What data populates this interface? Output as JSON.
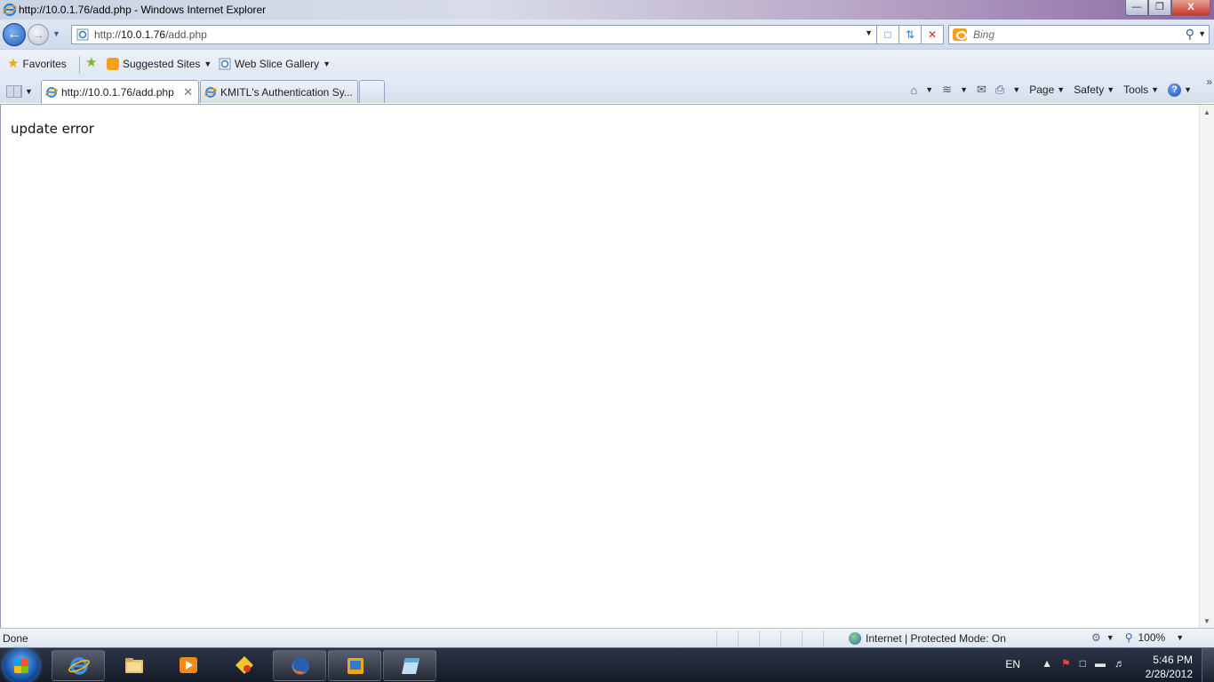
{
  "window": {
    "title": "http://10.0.1.76/add.php - Windows Internet Explorer",
    "minimize": "—",
    "restore": "❐",
    "close": "X"
  },
  "address_bar": {
    "url_prefix": "http://",
    "url_host": "10.0.1.76",
    "url_path": "/add.php",
    "search_placeholder": "Bing"
  },
  "favorites_bar": {
    "favorites_label": "Favorites",
    "suggested_sites_label": "Suggested Sites",
    "web_slice_gallery_label": "Web Slice Gallery"
  },
  "tabs": [
    {
      "label": "http://10.0.1.76/add.php",
      "active": true
    },
    {
      "label": "KMITL's Authentication Sy...",
      "active": false
    }
  ],
  "command_bar": {
    "page_label": "Page",
    "safety_label": "Safety",
    "tools_label": "Tools"
  },
  "page": {
    "body_text": "update error"
  },
  "status_bar": {
    "status_text": "Done",
    "zone_text": "Internet | Protected Mode: On",
    "zoom_text": "100%"
  },
  "taskbar": {
    "language": "EN",
    "time": "5:46 PM",
    "date": "2/28/2012",
    "apps": [
      "internet-explorer",
      "windows-explorer",
      "media-player",
      "folder-app",
      "firefox",
      "virtualbox",
      "notepad-app"
    ]
  },
  "colors": {
    "titlebar_accent": "#8a6aa5",
    "chrome_blue": "#dfe6f2",
    "taskbar": "#1d2433"
  }
}
